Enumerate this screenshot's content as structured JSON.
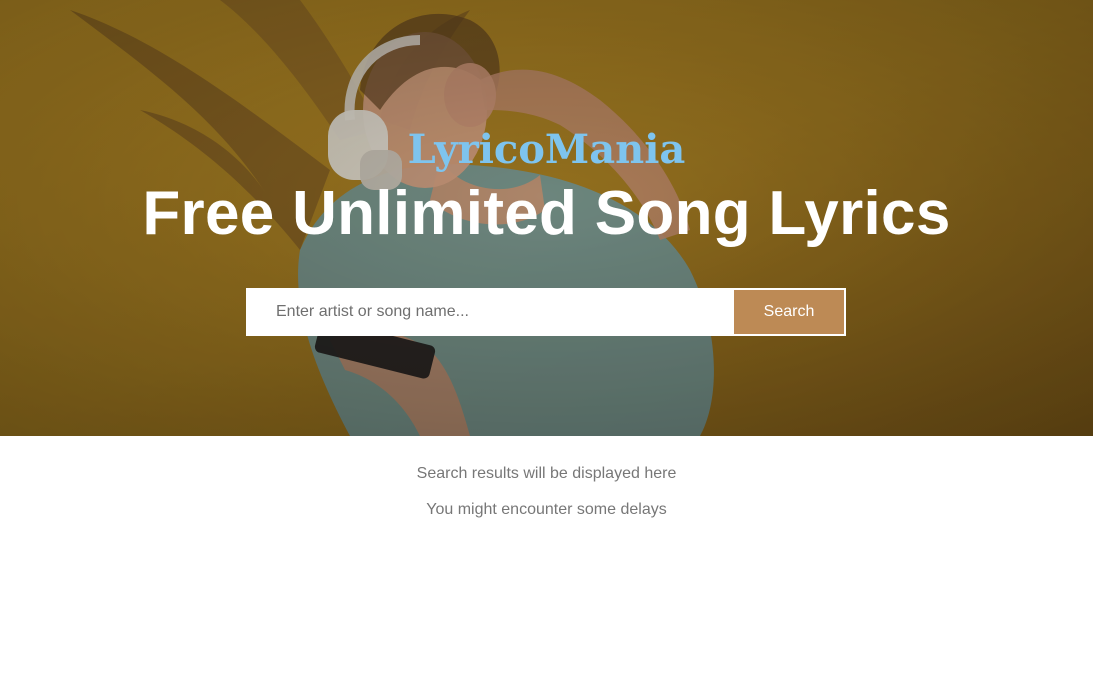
{
  "hero": {
    "brand": "LyricoMania",
    "headline": "Free Unlimited Song Lyrics",
    "background_color": "#a97e1f",
    "brand_color": "#7ec4ee"
  },
  "search": {
    "placeholder": "Enter artist or song name...",
    "value": "",
    "button_label": "Search",
    "button_color": "#bd8a55"
  },
  "results": {
    "message": "Search results will be displayed here",
    "note": "You might encounter some delays"
  }
}
